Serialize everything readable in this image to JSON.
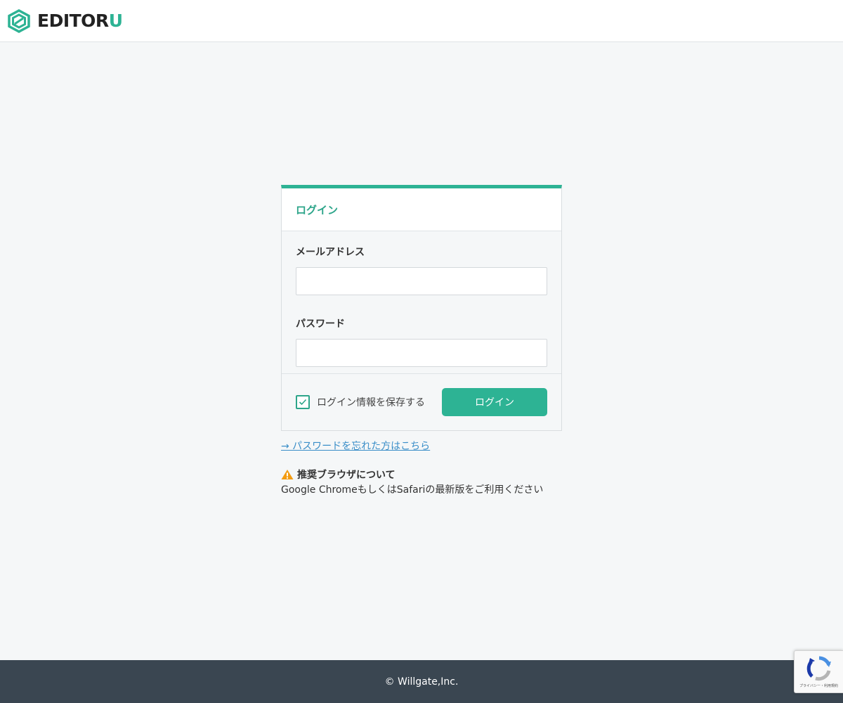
{
  "header": {
    "logo_text": "EDITOR",
    "logo_accent": "U",
    "brand_color": "#2db394"
  },
  "login": {
    "title": "ログイン",
    "email_label": "メールアドレス",
    "email_value": "",
    "password_label": "パスワード",
    "password_value": "",
    "remember_label": "ログイン情報を保存する",
    "remember_checked": true,
    "submit_label": "ログイン"
  },
  "forgot_link": "→ パスワードを忘れた方はこちら",
  "notice": {
    "icon": "warning-icon",
    "title": "推奨ブラウザについて",
    "text": "Google ChromeもしくはSafariの最新版をご利用ください"
  },
  "footer": {
    "copyright": "© Willgate,Inc."
  },
  "recaptcha": {
    "icon": "recaptcha-icon",
    "text": "プライバシー・利用規約"
  }
}
